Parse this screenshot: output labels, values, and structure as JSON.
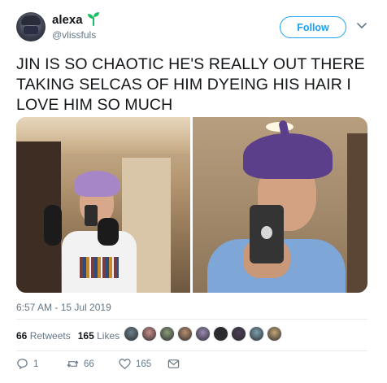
{
  "user": {
    "name": "alexa",
    "handle": "@vlissfuls"
  },
  "follow_label": "Follow",
  "tweet": {
    "text": "JIN IS SO CHAOTIC HE'S REALLY OUT THERE TAKING SELCAS OF HIM DYEING HIS HAIR I LOVE HIM SO MUCH",
    "timestamp": "6:57 AM - 15 Jul 2019"
  },
  "stats": {
    "retweets_count": "66",
    "retweets_label": "Retweets",
    "likes_count": "165",
    "likes_label": "Likes"
  },
  "liker_avatar_colors": [
    "#6b7f8c",
    "#c98f8a",
    "#8c9c7a",
    "#b88f6f",
    "#9a8bb5",
    "#2c2a2f",
    "#4a3c55",
    "#7c9fb0",
    "#c4a478"
  ],
  "actions": {
    "reply_count": "1",
    "retweet_count": "66",
    "like_count": "165"
  },
  "colors": {
    "accent": "#1da1f2",
    "text": "#14171a",
    "muted": "#657786",
    "divider": "#e6ecf0",
    "sprout": "#17bf63"
  },
  "icons": {
    "verified_sprout": "sprout-icon",
    "more": "chevron-down-icon",
    "reply": "reply-icon",
    "retweet": "retweet-icon",
    "like": "heart-icon",
    "dm": "envelope-icon"
  }
}
